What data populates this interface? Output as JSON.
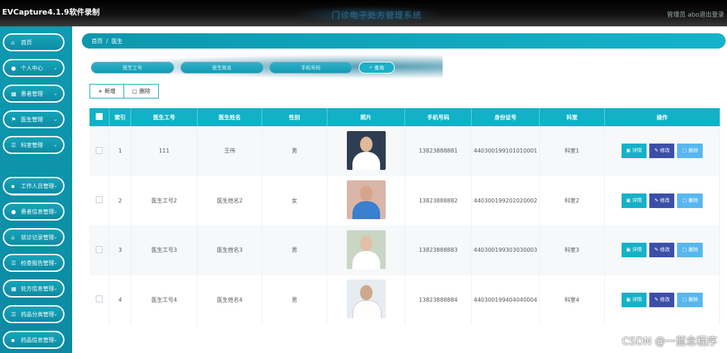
{
  "app": {
    "recorder_label": "EVCapture4.1.9软件录制",
    "title": "门诊电子处方管理系统",
    "user": "管理员 abo",
    "logout": "退出登录"
  },
  "sidebar": {
    "items": [
      {
        "label": "首页",
        "icon": "home-icon"
      },
      {
        "label": "个人中心",
        "icon": "user-icon"
      },
      {
        "label": "患者管理",
        "icon": "grid-icon"
      },
      {
        "label": "医生管理",
        "icon": "flag-icon"
      },
      {
        "label": "科室管理",
        "icon": "list-icon"
      },
      {
        "label": "工作人员管理",
        "icon": "card-icon"
      },
      {
        "label": "患者信息管理",
        "icon": "pin-icon"
      },
      {
        "label": "就诊记录管理",
        "icon": "house-icon"
      },
      {
        "label": "检查报告管理",
        "icon": "list-icon"
      },
      {
        "label": "处方信息管理",
        "icon": "grid-icon"
      },
      {
        "label": "药品分类管理",
        "icon": "list-icon"
      },
      {
        "label": "药品信息管理",
        "icon": "card-icon"
      }
    ],
    "sub_item": "科室"
  },
  "breadcrumb": {
    "home": "首页",
    "current": "医生"
  },
  "search": {
    "doctor_id_placeholder": "医生工号",
    "doctor_name_placeholder": "医生姓名",
    "phone_placeholder": "手机号码",
    "query_label": "查询"
  },
  "toolbar": {
    "add_label": "+ 新增",
    "delete_label": "删除"
  },
  "table": {
    "headers": [
      "索引",
      "医生工号",
      "医生姓名",
      "性别",
      "照片",
      "手机号码",
      "身份证号",
      "科室",
      "操作"
    ],
    "rows": [
      {
        "index": "1",
        "id": "111",
        "name": "王伟",
        "gender": "男",
        "phone": "13823888881",
        "idcard": "440300199101010001",
        "dept": "科室1"
      },
      {
        "index": "2",
        "id": "医生工号2",
        "name": "医生姓名2",
        "gender": "女",
        "phone": "13823888882",
        "idcard": "440300199202020002",
        "dept": "科室2"
      },
      {
        "index": "3",
        "id": "医生工号3",
        "name": "医生姓名3",
        "gender": "男",
        "phone": "13823888883",
        "idcard": "440300199303030003",
        "dept": "科室3"
      },
      {
        "index": "4",
        "id": "医生工号4",
        "name": "医生姓名4",
        "gender": "男",
        "phone": "13823888884",
        "idcard": "440300199404040004",
        "dept": "科室4"
      }
    ],
    "actions": {
      "detail": "详情",
      "edit": "修改",
      "delete": "删除"
    }
  },
  "watermark": "CSDN @一蓝念程序"
}
